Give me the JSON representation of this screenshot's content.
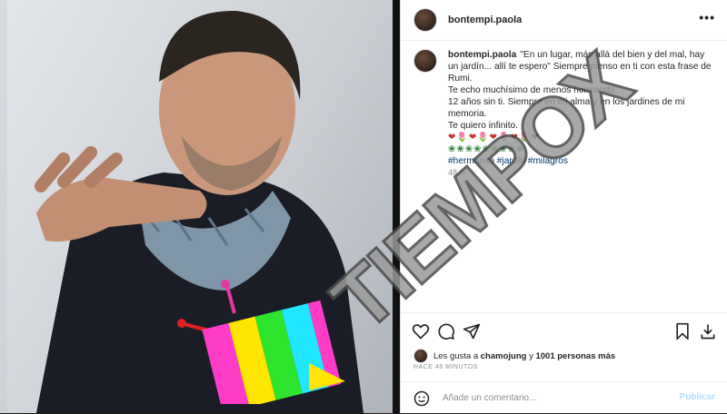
{
  "post": {
    "username": "bontempi.paola",
    "more_icon": "ellipsis-icon"
  },
  "caption": {
    "username": "bontempi.paola",
    "line1": "\"En un lugar, más allá del bien y del mal, hay un jardín... allí te espero\" Siempre pienso en ti con esta frase de Rumi.",
    "line2": "Te echo muchísimo de menos hermanito.",
    "line3": "12 años sin ti. Siempre en mi alma y en los jardines de mi memoria.",
    "line4": "Te quiero infinito.",
    "emojis_row1": "❤🌷❤🌷❤🌷❤🌷❤",
    "emojis_row2": "❀❀❀❀❀❀❀❀❀",
    "hashtags": "#hermanito #jardín #milagros",
    "age": "48 m"
  },
  "actions": {
    "like_icon": "heart-icon",
    "comment_icon": "comment-icon",
    "share_icon": "send-icon",
    "save_icon": "bookmark-icon",
    "extra_icon": "download-icon"
  },
  "likes": {
    "prefix": "Les gusta a",
    "user": "chamojung",
    "joiner": "y",
    "others": "1001 personas más"
  },
  "timestamp": "HACE 48 MINUTOS",
  "comment_box": {
    "emoji_icon": "smiley-icon",
    "placeholder": "Añade un comentario...",
    "publish_label": "Publicar"
  },
  "watermark": {
    "text": "TIEMPOX"
  }
}
